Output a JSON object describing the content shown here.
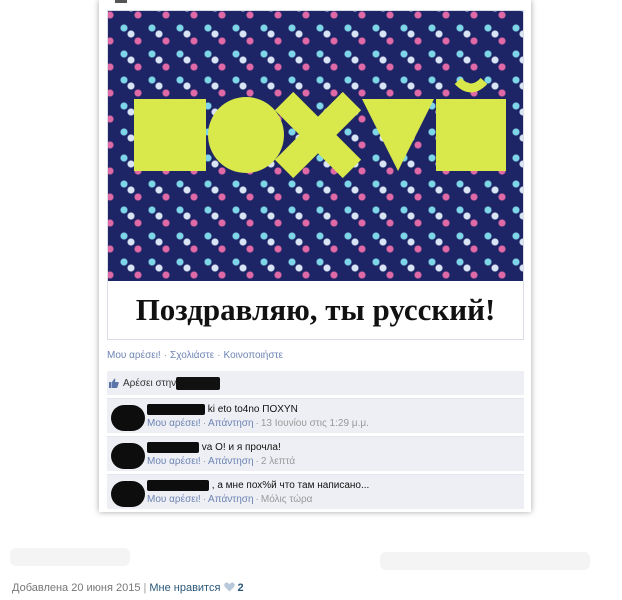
{
  "post": {
    "poster_word_glyphs": [
      "square",
      "circle",
      "cross",
      "triangle",
      "y-breve"
    ],
    "caption": "Поздравляю, ты русский!",
    "actions": [
      "Μου αρέσει!",
      "Σχολιάστε",
      "Κοινοποιήστε"
    ]
  },
  "likes": {
    "text": "Αρέσει στην "
  },
  "comments": [
    {
      "text": "ki eto to4no ΠΟΧΥΝ",
      "like": "Μου αρέσει!",
      "reply": "Απάντηση",
      "time": "13 Ιουνίου στις 1:29 μ.μ."
    },
    {
      "text": "va О! и я прочла!",
      "like": "Μου αρέσει!",
      "reply": "Απάντηση",
      "time": "2 λεπτά"
    },
    {
      "text": ", а мне пох%й что там написано...",
      "like": "Μου αρέσει!",
      "reply": "Απάντηση",
      "time": "Μόλις τώρα"
    }
  ],
  "footer": {
    "added": "Добавлена 20 июня 2015",
    "like_label": "Мне нравится",
    "like_count": "2"
  },
  "colors": {
    "poster_bg": "#1e2567",
    "shape_fill": "#d9e84a",
    "link": "#6d84b4",
    "footer_link": "#2b587a"
  }
}
